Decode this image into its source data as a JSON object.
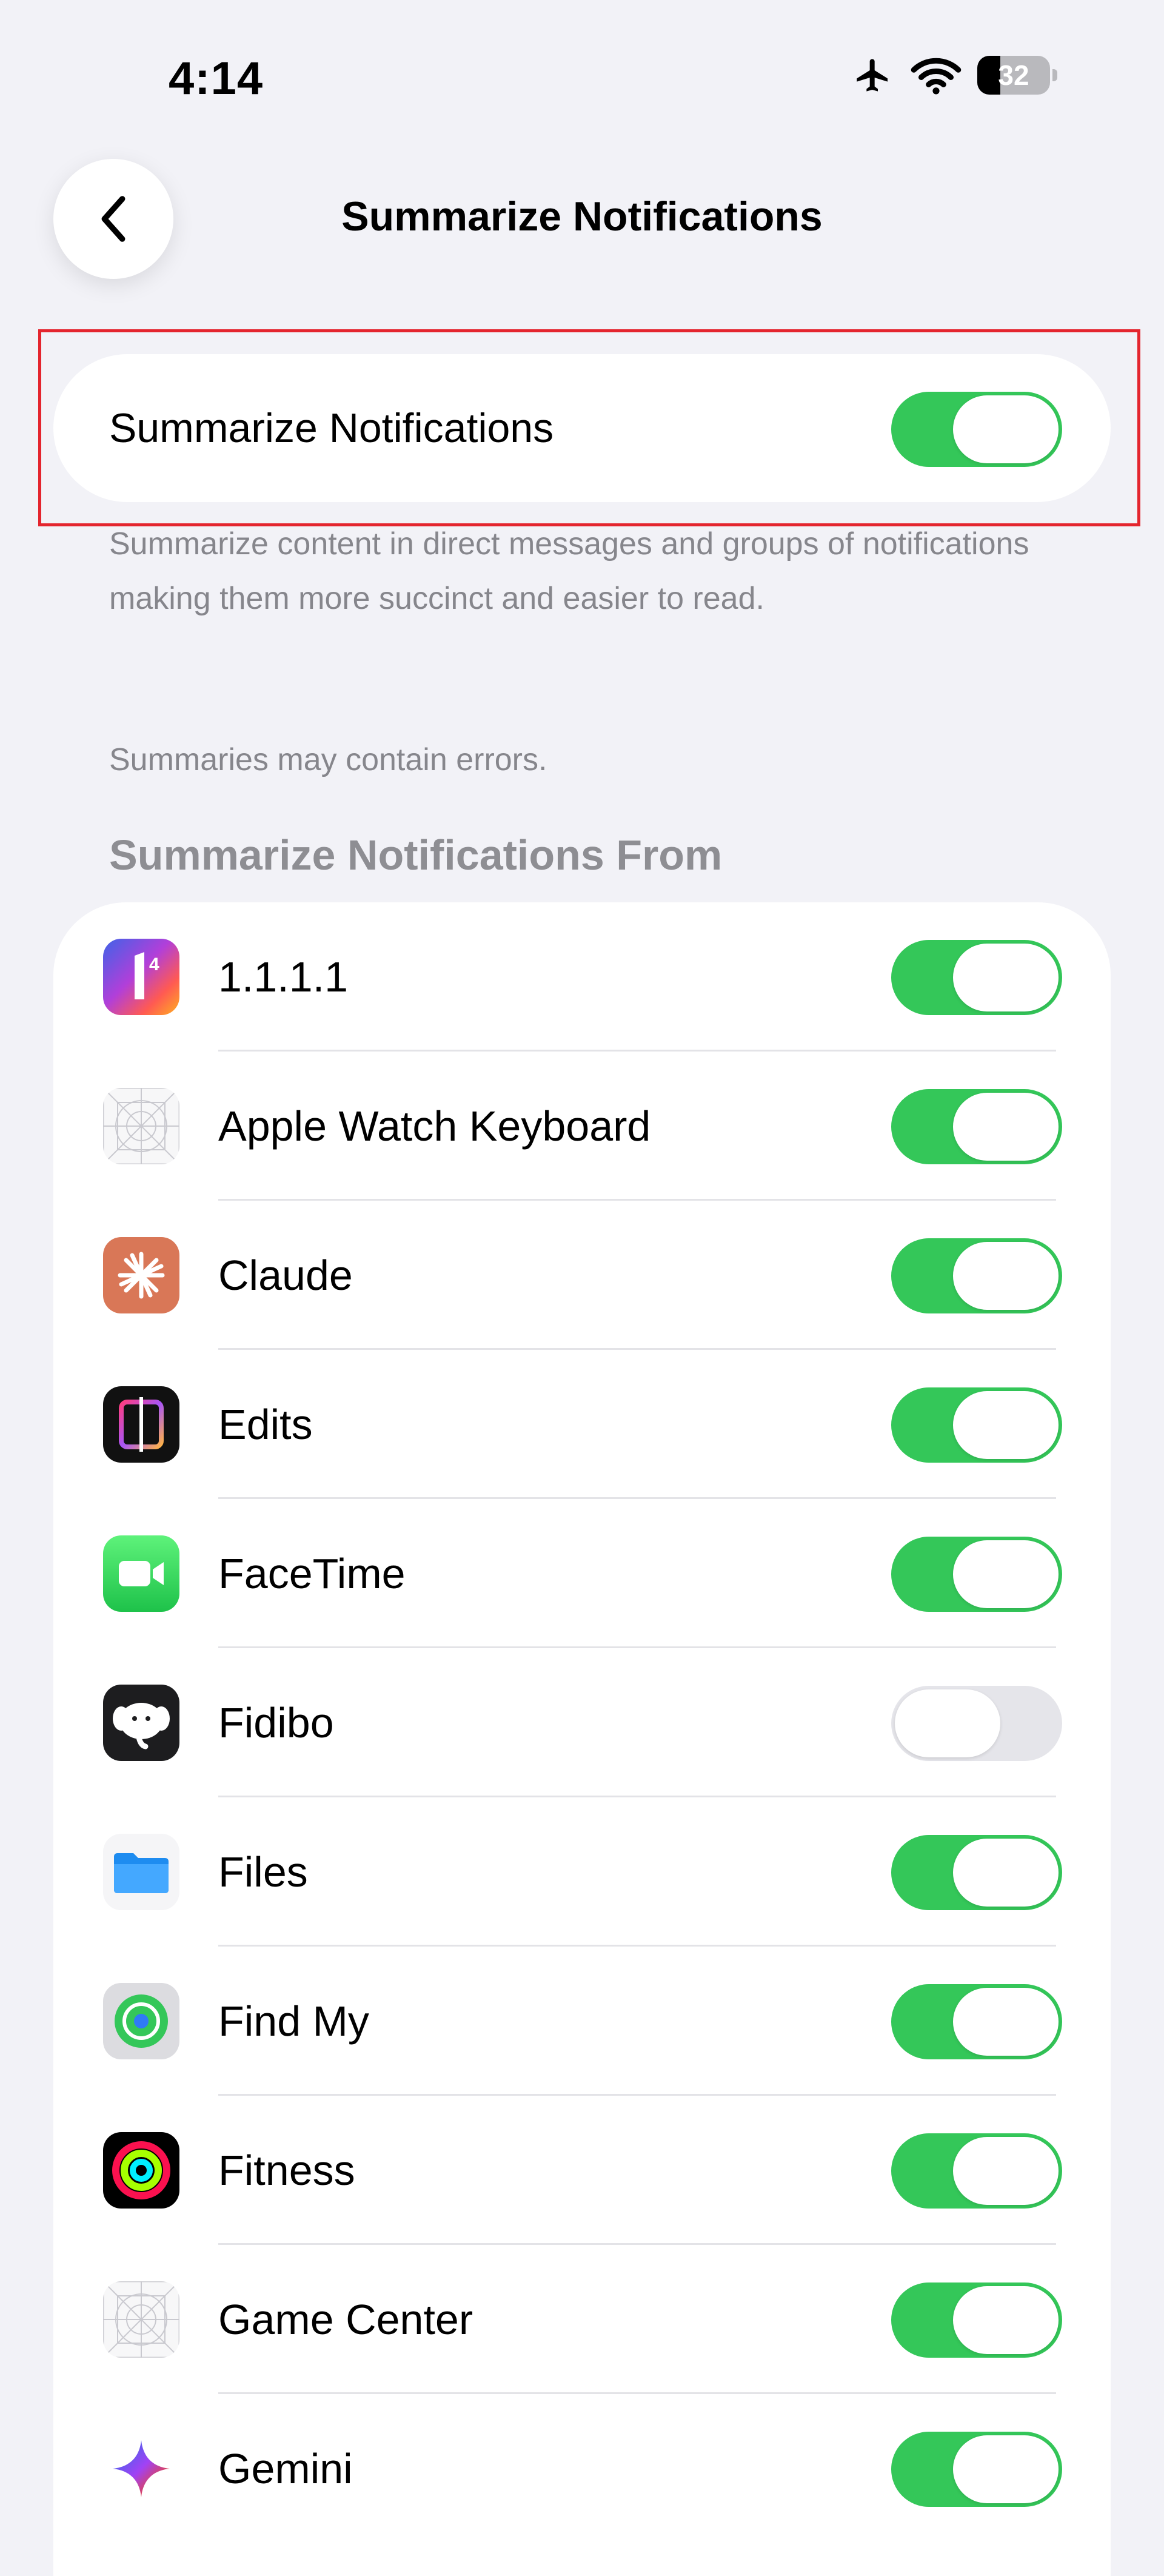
{
  "status_bar": {
    "time": "4:14",
    "battery_level": "32",
    "battery_fraction": 0.32
  },
  "nav": {
    "title": "Summarize Notifications",
    "back_icon": "chevron-left-icon"
  },
  "main_toggle": {
    "label": "Summarize Notifications",
    "enabled": true
  },
  "description": "Summarize content in direct messages and groups of notifications making them more succinct and easier to read.",
  "disclaimer": "Summaries may contain errors.",
  "section": {
    "header": "Summarize Notifications From"
  },
  "apps": [
    {
      "name": "1.1.1.1",
      "icon": "1111-icon",
      "enabled": true
    },
    {
      "name": "Apple Watch Keyboard",
      "icon": "apple-watch-keyboard-icon",
      "enabled": true
    },
    {
      "name": "Claude",
      "icon": "claude-icon",
      "enabled": true
    },
    {
      "name": "Edits",
      "icon": "edits-icon",
      "enabled": true
    },
    {
      "name": "FaceTime",
      "icon": "facetime-icon",
      "enabled": true
    },
    {
      "name": "Fidibo",
      "icon": "fidibo-icon",
      "enabled": false
    },
    {
      "name": "Files",
      "icon": "files-icon",
      "enabled": true
    },
    {
      "name": "Find My",
      "icon": "find-my-icon",
      "enabled": true
    },
    {
      "name": "Fitness",
      "icon": "fitness-icon",
      "enabled": true
    },
    {
      "name": "Game Center",
      "icon": "game-center-icon",
      "enabled": true
    },
    {
      "name": "Gemini",
      "icon": "gemini-icon",
      "enabled": true
    }
  ],
  "colors": {
    "toggle_on": "#34c759",
    "toggle_off": "#e5e5ea",
    "highlight": "#e4252e",
    "secondary_text": "#86868c"
  }
}
